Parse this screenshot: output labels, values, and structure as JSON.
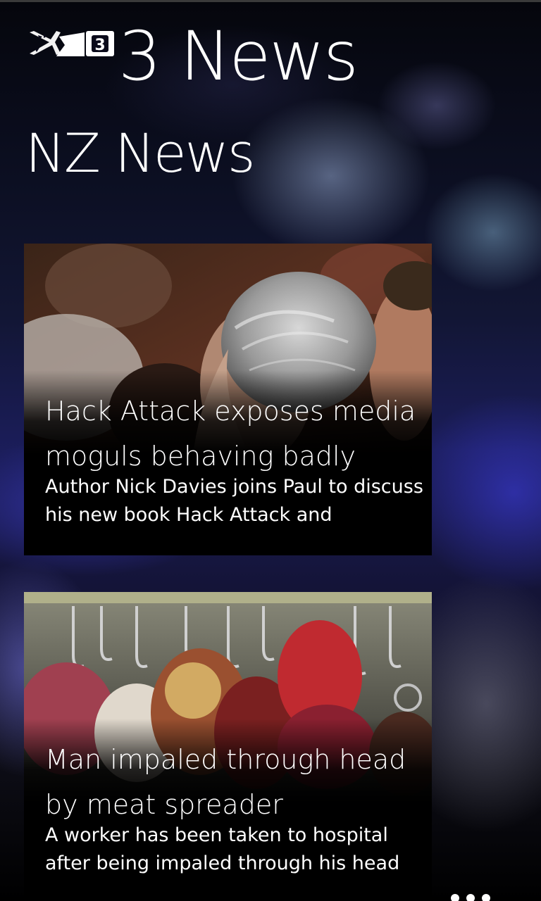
{
  "app": {
    "title": "3 News",
    "logo_icon": "tv3-fern-logo-icon"
  },
  "section": {
    "title": "NZ News"
  },
  "articles": [
    {
      "headline": "Hack Attack exposes media moguls behaving badly",
      "summary": "Author Nick Davies joins Paul to discuss his new book Hack Attack and",
      "image_icon": "news-photo-man-in-crowd"
    },
    {
      "headline": "Man impaled through head by meat spreader",
      "summary": "A worker has been taken to hospital after being impaled through his head",
      "image_icon": "news-photo-meat-on-hooks"
    }
  ],
  "app_bar": {
    "more_icon": "ellipsis-icon"
  },
  "colors": {
    "text": "#ffffff",
    "card_background": "#000000",
    "accent_blue": "#3a3ae0"
  }
}
